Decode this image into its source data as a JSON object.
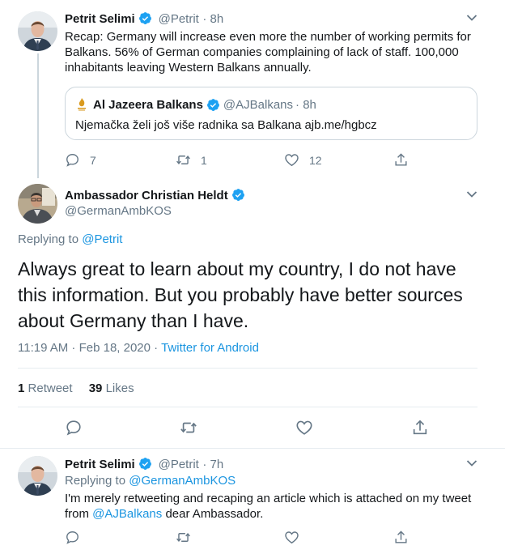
{
  "tweet1": {
    "name": "Petrit Selimi",
    "handle": "@Petrit",
    "time": "· 8h",
    "text": "Recap: Germany will increase even more the number of working permits for Balkans. 56% of German companies complaining of lack of staff. 100,000 inhabitants leaving Western Balkans annually.",
    "quote": {
      "name": "Al Jazeera Balkans",
      "handle": "@AJBalkans",
      "time": "· 8h",
      "text": "Njemačka želi još više radnika sa Balkana ajb.me/hgbcz"
    },
    "replies": "7",
    "retweets": "1",
    "likes": "12"
  },
  "main": {
    "name": "Ambassador Christian Heldt",
    "handle": "@GermanAmbKOS",
    "replying_prefix": "Replying to",
    "replying_to": "@Petrit",
    "text": "Always great to learn about my country, I do not have this information. But you probably have better sources about Germany than I have.",
    "timestamp": "11:19 AM · Feb 18, 2020 · ",
    "source": "Twitter for Android",
    "retweet_count": "1",
    "retweet_label": "Retweet",
    "like_count": "39",
    "like_label": "Likes"
  },
  "reply": {
    "name": "Petrit Selimi",
    "handle": "@Petrit",
    "time": "· 7h",
    "replying_prefix": "Replying to",
    "replying_to": "@GermanAmbKOS",
    "text_before": "I'm merely retweeting and recaping an article which is attached on my tweet from ",
    "mention": "@AJBalkans",
    "text_after": " dear Ambassador."
  },
  "colors": {
    "accent": "#1da1f2",
    "link": "#1b95e0",
    "muted": "#657786",
    "divider": "#e6ecf0"
  }
}
